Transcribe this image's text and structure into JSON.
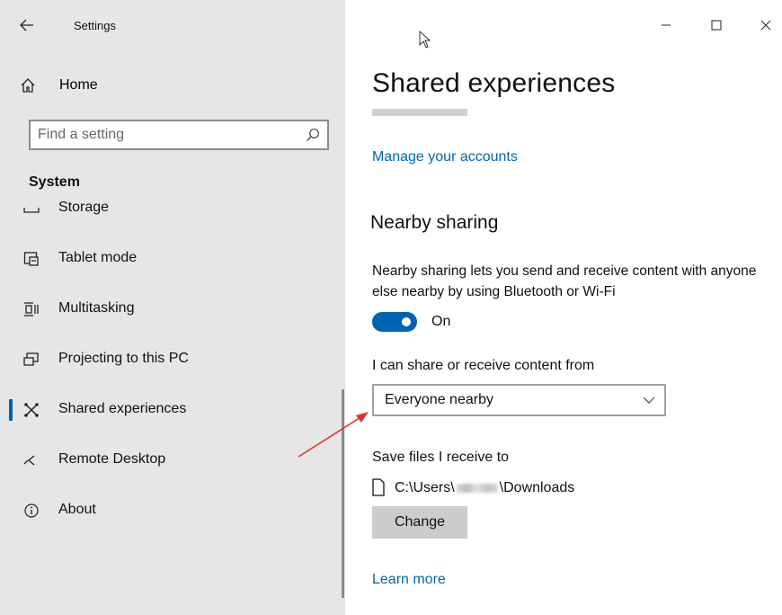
{
  "window": {
    "app_title": "Settings",
    "back_icon": "back-arrow-icon",
    "controls": [
      "minimize-icon",
      "maximize-icon",
      "close-icon"
    ]
  },
  "sidebar": {
    "home_label": "Home",
    "search_placeholder": "Find a setting",
    "section_heading": "System",
    "items": [
      {
        "label": "Storage",
        "icon": "storage-icon"
      },
      {
        "label": "Tablet mode",
        "icon": "tablet-mode-icon"
      },
      {
        "label": "Multitasking",
        "icon": "multitasking-icon"
      },
      {
        "label": "Projecting to this PC",
        "icon": "projecting-icon"
      },
      {
        "label": "Shared experiences",
        "icon": "shared-experiences-icon",
        "selected": true
      },
      {
        "label": "Remote Desktop",
        "icon": "remote-desktop-icon"
      },
      {
        "label": "About",
        "icon": "info-icon"
      }
    ]
  },
  "main": {
    "title": "Shared experiences",
    "manage_link": "Manage your accounts",
    "nearby": {
      "title": "Nearby sharing",
      "description": "Nearby sharing lets you send and receive content with anyone else nearby by using Bluetooth or Wi-Fi",
      "toggle_state": "On",
      "toggle_on": true,
      "share_label": "I can share or receive content from",
      "share_value": "Everyone nearby",
      "save_label": "Save files I receive to",
      "path_prefix": "C:\\Users\\",
      "path_suffix": "\\Downloads",
      "change_button": "Change",
      "learn_more": "Learn more"
    }
  },
  "colors": {
    "accent": "#0063b1",
    "link": "#0066b4",
    "sidebar_bg": "#e6e6e6",
    "annotation_arrow": "#e0312b"
  }
}
